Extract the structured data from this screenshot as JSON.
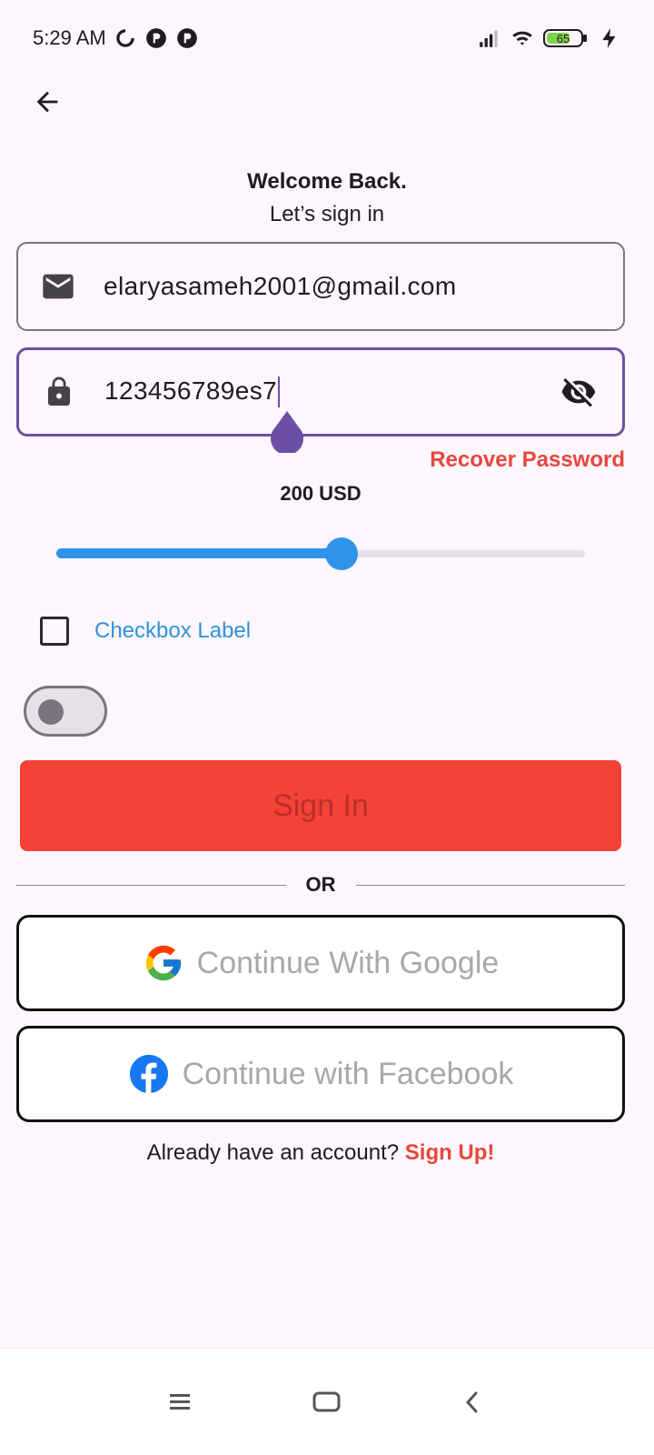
{
  "status_bar": {
    "time": "5:29 AM",
    "battery": "65",
    "icons": [
      "sync-icon",
      "notification-icon",
      "notification-icon",
      "signal-icon",
      "wifi-icon",
      "battery-icon",
      "charging-icon"
    ]
  },
  "header": {
    "back_icon": "arrow-left-icon"
  },
  "welcome": {
    "title": "Welcome Back.",
    "subtitle": "Let’s sign in"
  },
  "form": {
    "email": {
      "icon": "mail-icon",
      "value": "elaryasameh2001@gmail.com"
    },
    "password": {
      "icon": "lock-icon",
      "value": "123456789es7",
      "toggle_icon": "eye-off-icon"
    },
    "recover_label": "Recover Password"
  },
  "slider": {
    "label": "200 USD",
    "value_fraction": 0.54,
    "color": "#2f93ea"
  },
  "checkbox": {
    "label": "Checkbox Label",
    "checked": false
  },
  "switch": {
    "on": false
  },
  "buttons": {
    "sign_in": "Sign In",
    "or": "OR",
    "google": "Continue With Google",
    "facebook": "Continue with Facebook"
  },
  "footer": {
    "prompt": "Already have an account?",
    "link": "Sign Up!"
  },
  "colors": {
    "accent": "#e8473d",
    "primary_button": "#f44336",
    "focus": "#6b50a6",
    "link": "#2f93d8"
  },
  "nav_bar": {
    "icons": [
      "menu-icon",
      "home-icon",
      "back-icon"
    ]
  }
}
